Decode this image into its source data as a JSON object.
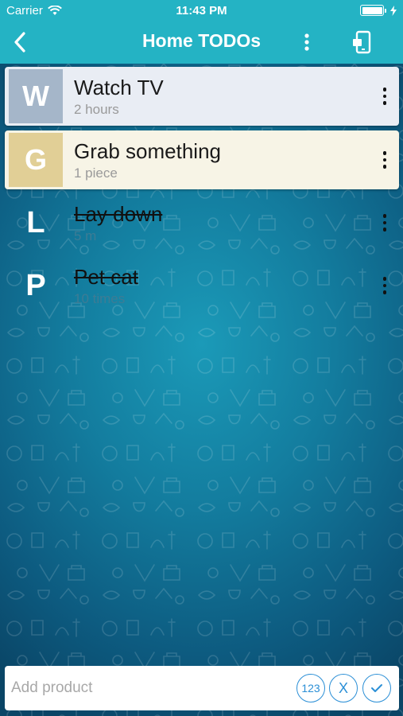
{
  "status": {
    "carrier": "Carrier",
    "time": "11:43 PM"
  },
  "nav": {
    "title": "Home TODOs",
    "back_icon": "chevron-left-icon",
    "more_icon": "more-vertical-icon",
    "share_icon": "phone-share-icon"
  },
  "items": [
    {
      "letter": "W",
      "title": "Watch TV",
      "subtitle": "2 hours",
      "done": false,
      "badge_color": "#a5b6c9",
      "card_color": "#e9edf4"
    },
    {
      "letter": "G",
      "title": "Grab something",
      "subtitle": "1 piece",
      "done": false,
      "badge_color": "#e1cf96",
      "card_color": "#f7f4e6"
    },
    {
      "letter": "L",
      "title": "Lay down",
      "subtitle": "5 m",
      "done": true
    },
    {
      "letter": "P",
      "title": "Pet cat",
      "subtitle": "10 times",
      "done": true
    }
  ],
  "input": {
    "placeholder": "Add product",
    "numeric_label": "123",
    "clear_label": "X"
  },
  "colors": {
    "accent": "#24b3c4",
    "button_blue": "#2b8fd6"
  }
}
